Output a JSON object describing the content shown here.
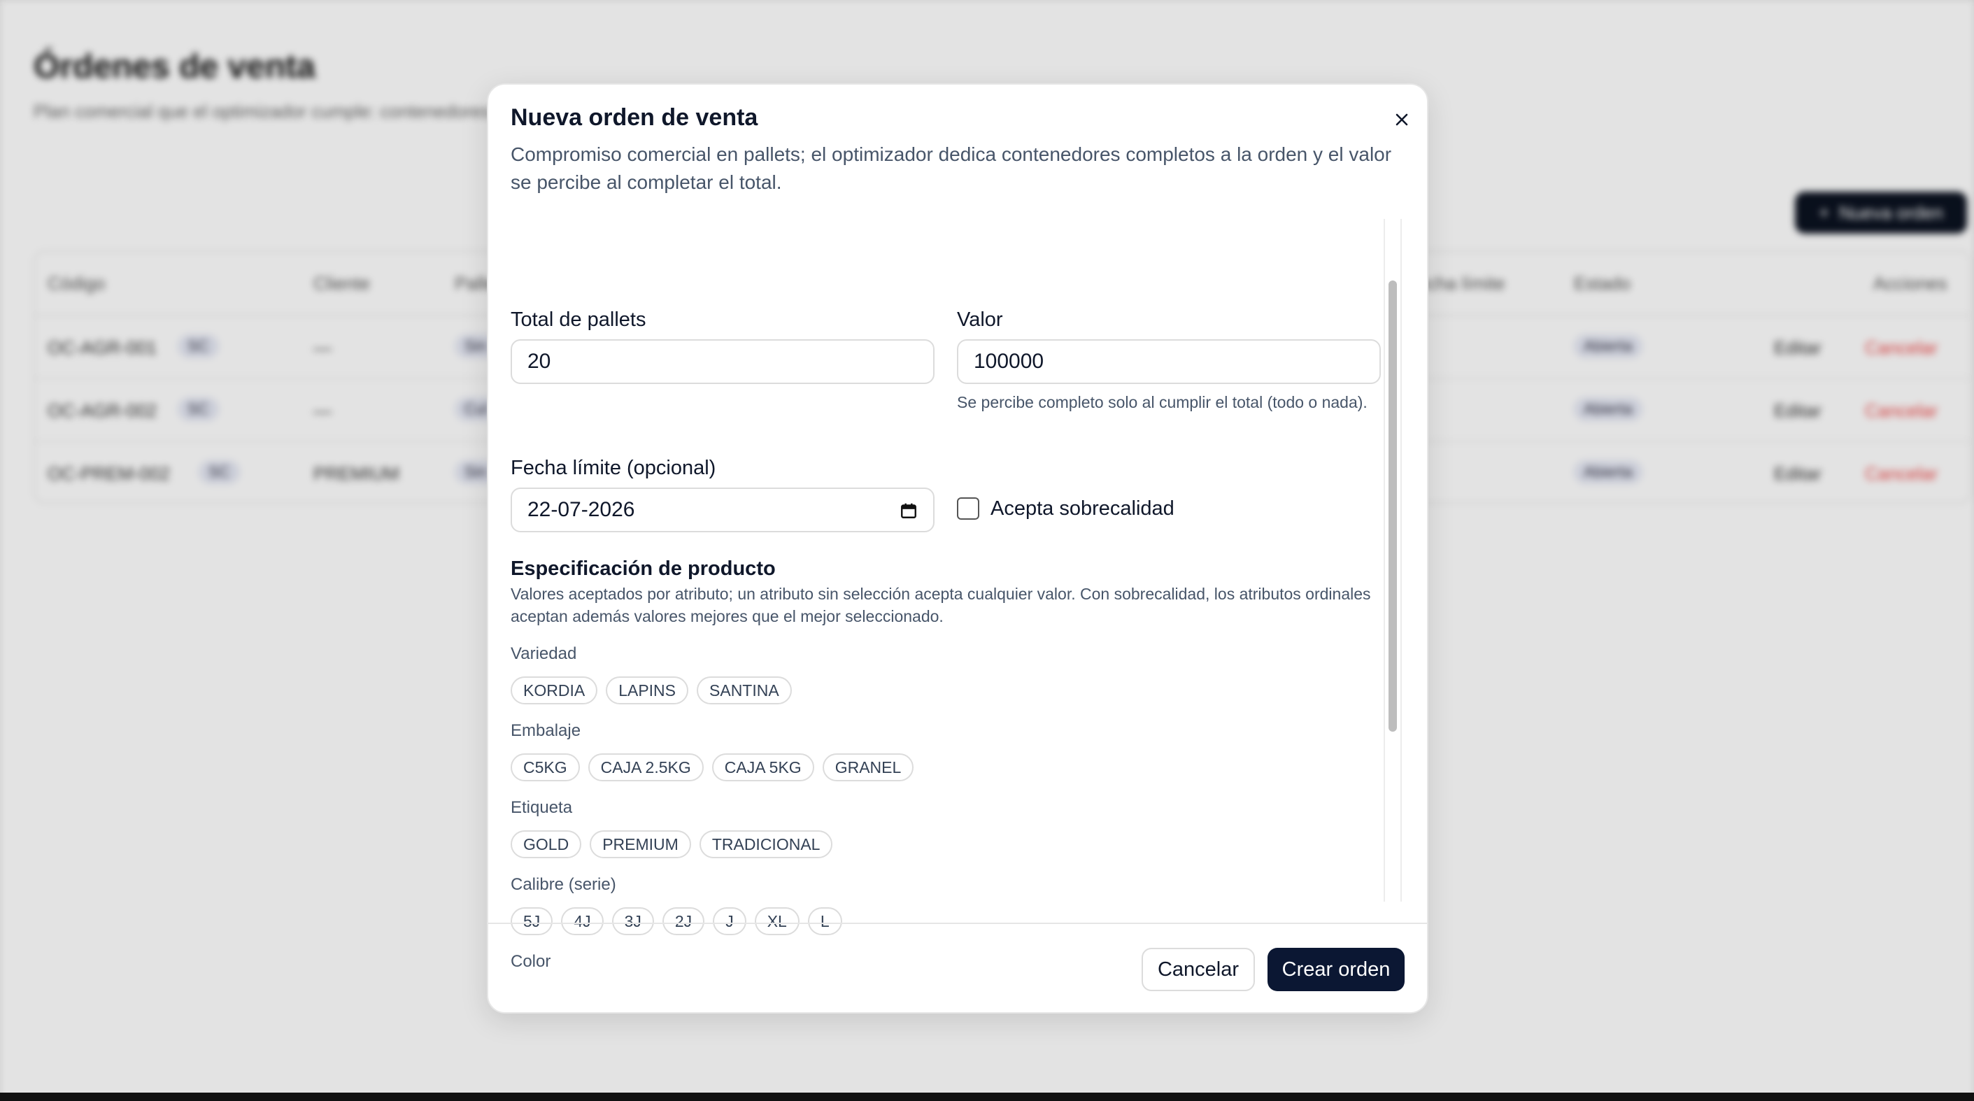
{
  "background": {
    "title": "Órdenes de venta",
    "subtitle": "Plan comercial que el optimizador cumple: contenedores completos por orden",
    "new_order_label": "Nueva orden",
    "table_headers": [
      "Código",
      "Cliente",
      "Pallets",
      "Fecha límite",
      "Estado",
      "Acciones"
    ],
    "rows": [
      {
        "code": "OC-AGR-001",
        "badge": "SC",
        "client": "—",
        "chip": "Sin",
        "status": "Abierta",
        "edit": "Editar",
        "cancel": "Cancelar"
      },
      {
        "code": "OC-AGR-002",
        "badge": "SC",
        "client": "—",
        "chip": "Cul",
        "status": "Abierta",
        "edit": "Editar",
        "cancel": "Cancelar"
      },
      {
        "code": "OC-PREM-002",
        "badge": "SC",
        "client": "PREMIUM",
        "chip": "Sin",
        "status": "Abierta",
        "edit": "Editar",
        "cancel": "Cancelar"
      }
    ]
  },
  "modal": {
    "title": "Nueva orden de venta",
    "description": "Compromiso comercial en pallets; el optimizador dedica contenedores completos a la orden y el valor se percibe al completar el total.",
    "total_pallets": {
      "label": "Total de pallets",
      "value": "20"
    },
    "valor": {
      "label": "Valor",
      "value": "100000",
      "help": "Se percibe completo solo al cumplir el total (todo o nada)."
    },
    "fecha_limite": {
      "label": "Fecha límite (opcional)",
      "value": "22-07-2026"
    },
    "sobrecalidad": {
      "label": "Acepta sobrecalidad",
      "checked": false
    },
    "spec": {
      "title": "Especificación de producto",
      "description": "Valores aceptados por atributo; un atributo sin selección acepta cualquier valor. Con sobrecalidad, los atributos ordinales aceptan además valores mejores que el mejor seleccionado.",
      "attributes": [
        {
          "label": "Variedad",
          "options": [
            "KORDIA",
            "LAPINS",
            "SANTINA"
          ]
        },
        {
          "label": "Embalaje",
          "options": [
            "C5KG",
            "CAJA 2.5KG",
            "CAJA 5KG",
            "GRANEL"
          ]
        },
        {
          "label": "Etiqueta",
          "options": [
            "GOLD",
            "PREMIUM",
            "TRADICIONAL"
          ]
        },
        {
          "label": "Calibre (serie)",
          "options": [
            "5J",
            "4J",
            "3J",
            "2J",
            "J",
            "XL",
            "L"
          ]
        },
        {
          "label": "Color",
          "options": []
        }
      ]
    },
    "cancel_label": "Cancelar",
    "create_label": "Crear orden"
  }
}
